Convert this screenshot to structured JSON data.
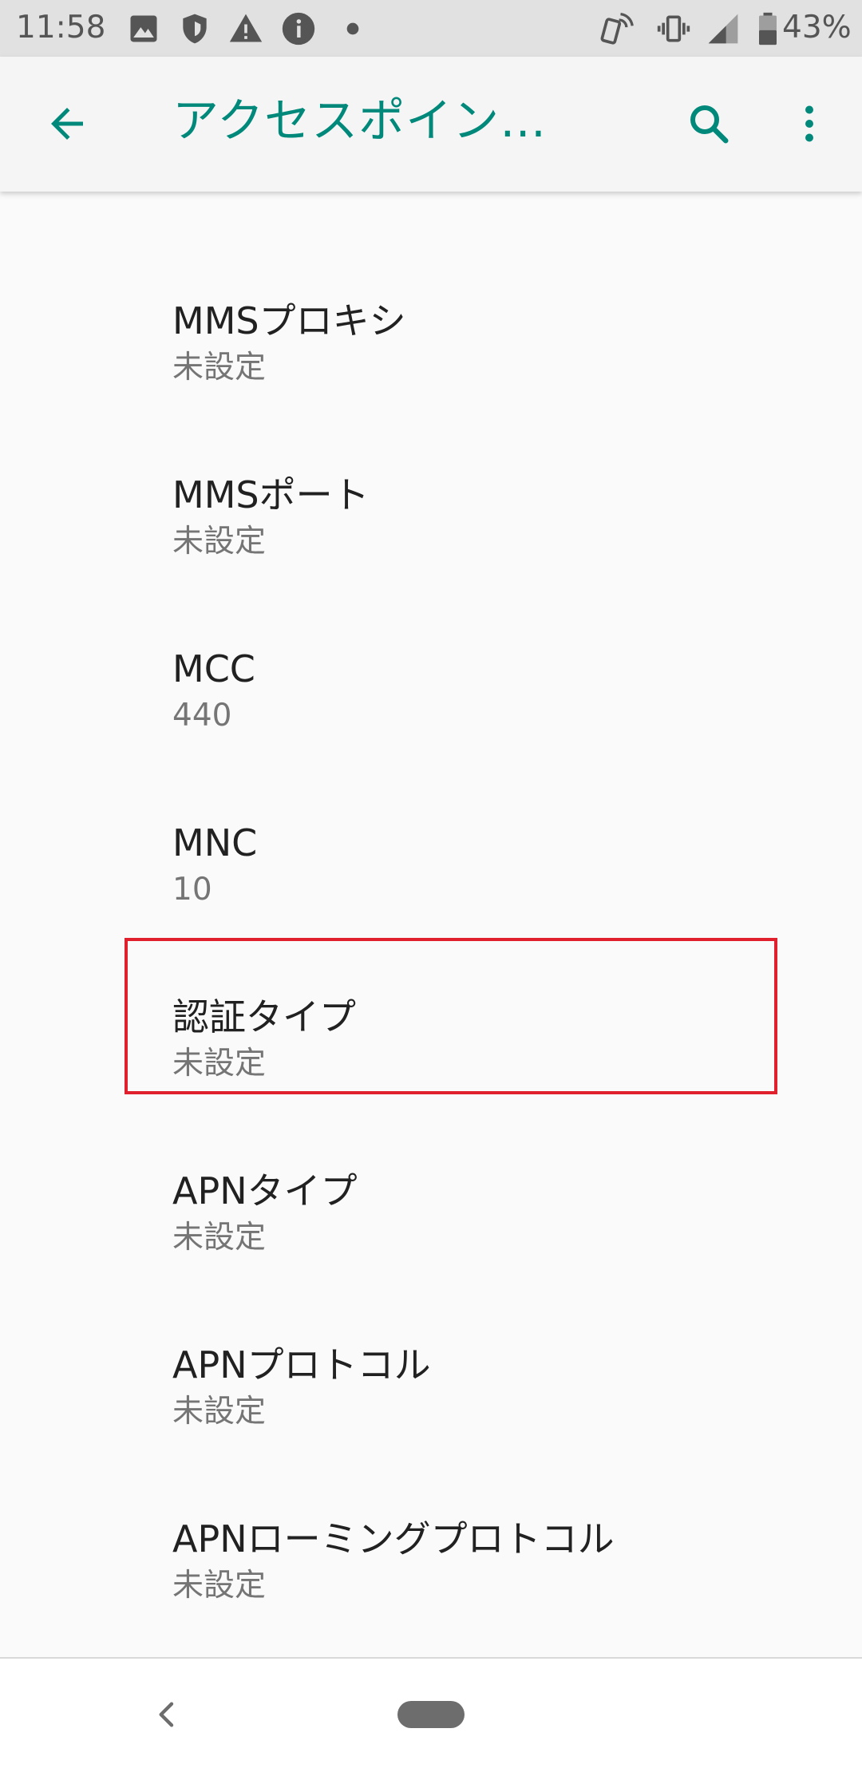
{
  "status_bar": {
    "time": "11:58",
    "battery_percent": "43%",
    "icons": [
      "image-icon",
      "shield-icon",
      "warning-icon",
      "info-icon",
      "dot-icon",
      "nfc-phone-icon",
      "vibrate-icon",
      "signal-icon",
      "battery-icon"
    ]
  },
  "app_bar": {
    "title": "アクセスポイント…",
    "back_icon": "arrow-back-icon",
    "search_icon": "search-icon",
    "more_icon": "more-vert-icon",
    "accent_color": "#00897b"
  },
  "settings_list": {
    "items": [
      {
        "title": "MMSプロキシ",
        "summary": "未設定"
      },
      {
        "title": "MMSポート",
        "summary": "未設定"
      },
      {
        "title": "MCC",
        "summary": "440"
      },
      {
        "title": "MNC",
        "summary": "10"
      },
      {
        "title": "認証タイプ",
        "summary": "未設定",
        "highlighted": true
      },
      {
        "title": "APNタイプ",
        "summary": "未設定"
      },
      {
        "title": "APNプロトコル",
        "summary": "未設定"
      },
      {
        "title": "APNローミングプロトコル",
        "summary": "未設定"
      }
    ],
    "highlight_color": "#e0202c"
  },
  "nav_bar": {
    "back_icon": "nav-back-icon",
    "home_icon": "home-pill-icon"
  }
}
